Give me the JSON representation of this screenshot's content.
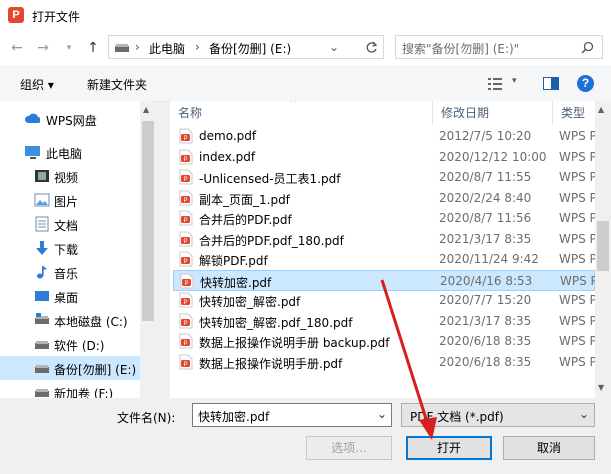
{
  "window": {
    "title": "打开文件"
  },
  "nav": {
    "breadcrumb": [
      "此电脑",
      "备份[勿删] (E:)"
    ],
    "search_placeholder": "搜索\"备份[勿删] (E:)\""
  },
  "toolbar": {
    "organize_label": "组织 ▾",
    "new_folder_label": "新建文件夹"
  },
  "sidebar": {
    "items": [
      {
        "label": "WPS网盘",
        "icon": "cloud-icon"
      },
      {
        "label": "此电脑",
        "icon": "computer-icon"
      },
      {
        "label": "视频",
        "icon": "video-icon"
      },
      {
        "label": "图片",
        "icon": "picture-icon"
      },
      {
        "label": "文档",
        "icon": "document-icon"
      },
      {
        "label": "下载",
        "icon": "download-icon"
      },
      {
        "label": "音乐",
        "icon": "music-icon"
      },
      {
        "label": "桌面",
        "icon": "desktop-icon"
      },
      {
        "label": "本地磁盘 (C:)",
        "icon": "drive-icon"
      },
      {
        "label": "软件 (D:)",
        "icon": "drive-icon"
      },
      {
        "label": "备份[勿删] (E:)",
        "icon": "drive-icon"
      },
      {
        "label": "新加卷 (F:)",
        "icon": "drive-icon"
      }
    ]
  },
  "files": {
    "columns": [
      "名称",
      "修改日期",
      "类型"
    ],
    "rows": [
      {
        "name": "demo.pdf",
        "date": "2012/7/5 10:20",
        "type": "WPS PDF"
      },
      {
        "name": "index.pdf",
        "date": "2020/12/12 10:00",
        "type": "WPS PDF"
      },
      {
        "name": "-Unlicensed-员工表1.pdf",
        "date": "2020/8/7 11:55",
        "type": "WPS PDF"
      },
      {
        "name": "副本_页面_1.pdf",
        "date": "2020/2/24 8:40",
        "type": "WPS PDF"
      },
      {
        "name": "合并后的PDF.pdf",
        "date": "2020/8/7 11:56",
        "type": "WPS PDF"
      },
      {
        "name": "合并后的PDF.pdf_180.pdf",
        "date": "2021/3/17 8:35",
        "type": "WPS PDF"
      },
      {
        "name": "解锁PDF.pdf",
        "date": "2020/11/24 9:42",
        "type": "WPS PDF"
      },
      {
        "name": "快转加密.pdf",
        "date": "2020/4/16 8:53",
        "type": "WPS PDF"
      },
      {
        "name": "快转加密_解密.pdf",
        "date": "2020/7/7 15:20",
        "type": "WPS PDF"
      },
      {
        "name": "快转加密_解密.pdf_180.pdf",
        "date": "2021/3/17 8:35",
        "type": "WPS PDF"
      },
      {
        "name": "数据上报操作说明手册 backup.pdf",
        "date": "2020/6/18 8:35",
        "type": "WPS PDF"
      },
      {
        "name": "数据上报操作说明手册.pdf",
        "date": "2020/6/18 8:35",
        "type": "WPS PDF"
      }
    ],
    "selected_index": 7
  },
  "footer": {
    "filename_label": "文件名(N):",
    "filename_value": "快转加密.pdf",
    "filetype_value": "PDF 文档 (*.pdf)",
    "options_label": "选项...",
    "open_label": "打开",
    "cancel_label": "取消"
  },
  "colors": {
    "accent_red": "#e2472f",
    "selection": "#cce8ff",
    "arrow": "#d81e1e"
  }
}
